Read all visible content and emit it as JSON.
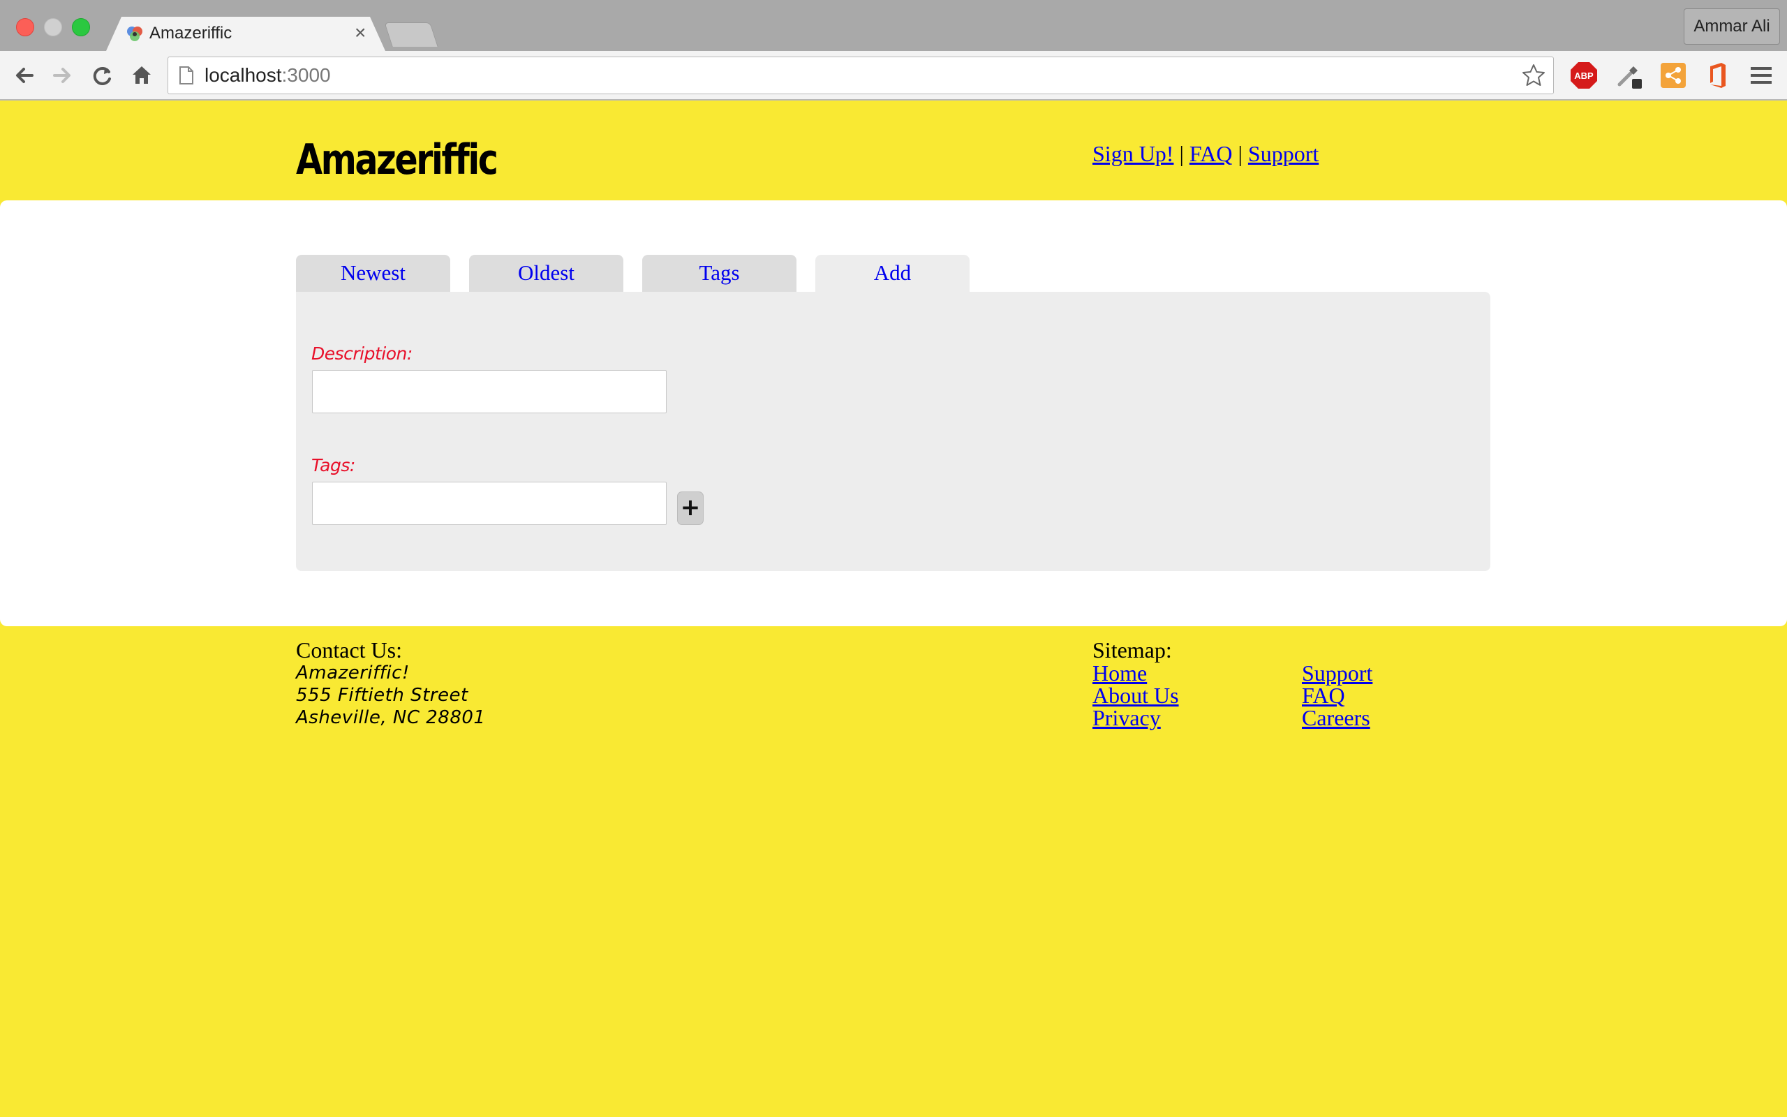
{
  "browser": {
    "tab_title": "Amazeriffic",
    "tab_close": "×",
    "url_host": "localhost",
    "url_port": ":3000",
    "profile_name": "Ammar Ali",
    "extensions": [
      "abp-icon",
      "eyedropper-icon",
      "share-icon",
      "office-icon"
    ],
    "colors": {
      "chrome_bg": "#a9a9a9",
      "toolbar_bg": "#f3f3f3"
    }
  },
  "header": {
    "logo": "Amazeriffic",
    "nav": [
      {
        "label": "Sign Up!"
      },
      {
        "label": "FAQ"
      },
      {
        "label": "Support"
      }
    ],
    "separator": "|"
  },
  "main": {
    "tabs": [
      {
        "label": "Newest",
        "active": false
      },
      {
        "label": "Oldest",
        "active": false
      },
      {
        "label": "Tags",
        "active": false
      },
      {
        "label": "Add",
        "active": true
      }
    ],
    "form": {
      "description_label": "Description:",
      "description_value": "",
      "tags_label": "Tags:",
      "tags_value": "",
      "add_button": "+"
    }
  },
  "footer": {
    "contact_heading": "Contact Us:",
    "contact_lines": [
      "Amazeriffic!",
      "555 Fiftieth Street",
      "Asheville, NC 28801"
    ],
    "sitemap_heading": "Sitemap:",
    "sitemap_col1": [
      "Home",
      "About Us",
      "Privacy"
    ],
    "sitemap_col2": [
      "Support",
      "FAQ",
      "Careers"
    ]
  },
  "colors": {
    "page_bg": "#f9e933",
    "content_bg": "#ffffff",
    "panel_bg": "#ededed",
    "tab_bg": "#dddddd",
    "link": "#0000ee",
    "label_red": "#e8102a"
  }
}
